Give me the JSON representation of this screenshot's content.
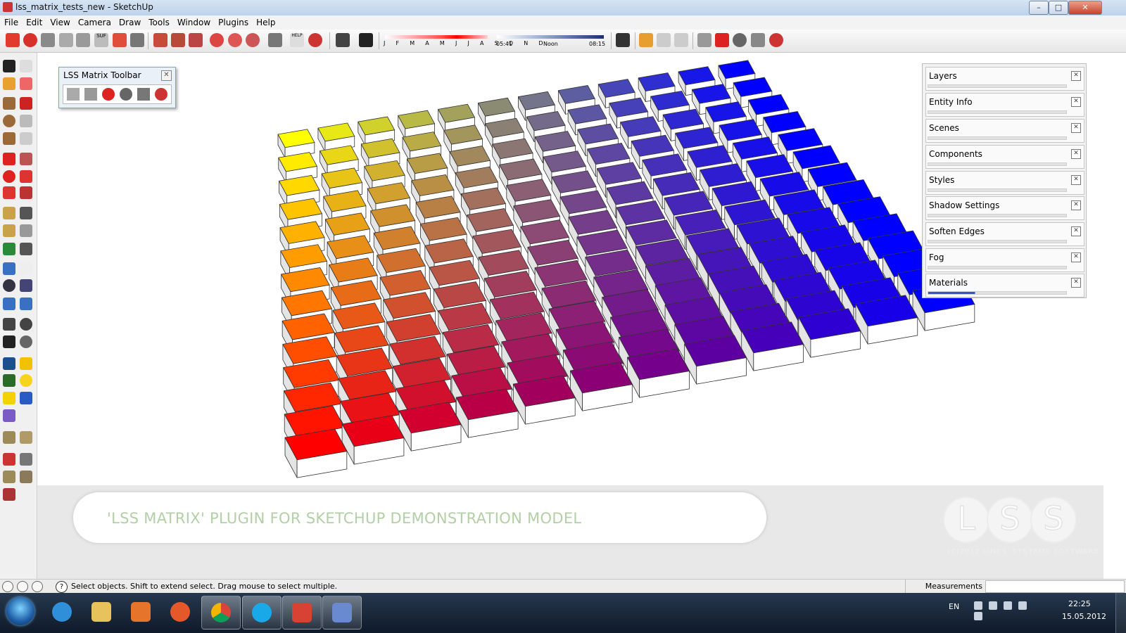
{
  "window": {
    "title": "lss_matrix_tests_new - SketchUp",
    "controls": {
      "minimize": "–",
      "maximize": "□",
      "close": "✕"
    }
  },
  "menubar": {
    "items": [
      "File",
      "Edit",
      "View",
      "Camera",
      "Draw",
      "Tools",
      "Window",
      "Plugins",
      "Help"
    ]
  },
  "toolbar": {
    "shadow_months": "J F M A M J J A S O N D",
    "time_start": "05:41",
    "time_mid": "Noon",
    "time_end": "08:15",
    "sun_label": "SUF",
    "help_label": "HELP"
  },
  "lss_toolbar": {
    "title": "LSS Matrix Toolbar",
    "close": "✕"
  },
  "tray": {
    "panels": [
      {
        "label": "Layers"
      },
      {
        "label": "Entity Info"
      },
      {
        "label": "Scenes"
      },
      {
        "label": "Components"
      },
      {
        "label": "Styles"
      },
      {
        "label": "Shadow Settings"
      },
      {
        "label": "Soften Edges"
      },
      {
        "label": "Fog"
      },
      {
        "label": "Materials"
      }
    ],
    "close": "✕"
  },
  "model": {
    "banner": "'LSS MATRIX' PLUGIN FOR SKETCHUP DEMONSTRATION MODEL",
    "logo_text": "LSS",
    "copyright": "(C)2012 LINKS' SYSTEMS SOFTWARE",
    "corner_colors": {
      "near_left": "#ff0000",
      "far_left": "#ffff00",
      "far_right": "#0000ff",
      "near_right": "#0000ff"
    }
  },
  "statusbar": {
    "help": "?",
    "text": "Select objects. Shift to extend select. Drag mouse to select multiple.",
    "measurements_label": "Measurements",
    "measurements_value": ""
  },
  "taskbar": {
    "lang": "EN",
    "time": "22:25",
    "date": "15.05.2012",
    "apps": [
      "internet-explorer",
      "explorer",
      "media-player",
      "firefox",
      "chrome",
      "skype",
      "sketchup",
      "other-app"
    ]
  }
}
